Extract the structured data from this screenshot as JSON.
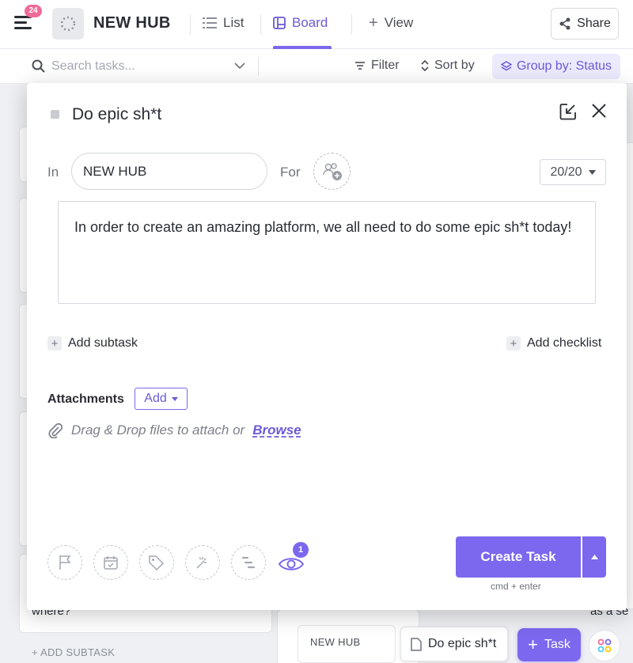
{
  "topbar": {
    "notification_count": "24",
    "title": "NEW HUB",
    "views": [
      {
        "label": "List",
        "active": false
      },
      {
        "label": "Board",
        "active": true
      },
      {
        "label": "View",
        "active": false
      }
    ],
    "share_label": "Share"
  },
  "subbar": {
    "search_placeholder": "Search tasks...",
    "filter_label": "Filter",
    "sort_label": "Sort by",
    "group_label": "Group by: Status"
  },
  "background": {
    "left_col_line": "where?",
    "add_subtask": "+ ADD SUBTASK",
    "bottom_card_title": "NEW HUB",
    "doc_chip": "Do epic sh*t",
    "task_button": "Task",
    "right_col_snippet": "as a se"
  },
  "modal": {
    "task_name": "Do epic sh*t",
    "in_label": "In",
    "list_name": "NEW HUB",
    "for_label": "For",
    "points": "20/20",
    "description": "In order to create an amazing platform, we all need to do some epic sh*t today!",
    "add_subtask": "Add subtask",
    "add_checklist": "Add checklist",
    "attachments_label": "Attachments",
    "add_attachment": "Add",
    "drop_text": "Drag & Drop files to attach or",
    "browse_label": "Browse",
    "watcher_count": "1",
    "create_label": "Create Task",
    "shortcut": "cmd + enter",
    "toolbar_icons": [
      "flag-icon",
      "calendar-icon",
      "tag-icon",
      "magic-wand-icon",
      "gantt-icon",
      "eye-icon"
    ]
  },
  "colors": {
    "accent": "#7b68ee",
    "badge": "#f06a9a"
  }
}
